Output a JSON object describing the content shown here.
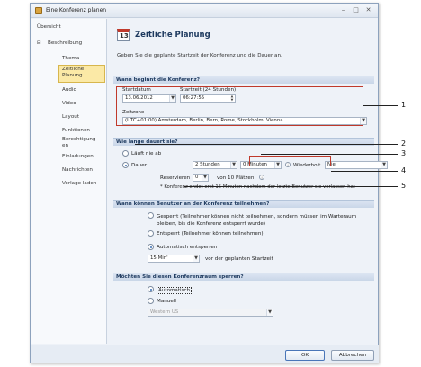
{
  "window": {
    "title": "Eine Konferenz planen"
  },
  "nav": {
    "items": [
      {
        "label": "Übersicht",
        "sub": false
      },
      {
        "label": "Beschreibung",
        "sub": false,
        "expanded_marker": "⊟"
      },
      {
        "label": "Thema",
        "sub": true
      },
      {
        "label": "Zeitliche\nPlanung",
        "sub": true,
        "selected": true
      },
      {
        "label": "Audio",
        "sub": true
      },
      {
        "label": "Video",
        "sub": true
      },
      {
        "label": "Layout",
        "sub": true
      },
      {
        "label": "Funktionen",
        "sub": true
      },
      {
        "label": "Berechtigung\nen",
        "sub": true
      },
      {
        "label": "Einladungen",
        "sub": true
      },
      {
        "label": "Nachrichten",
        "sub": true
      },
      {
        "label": "Vorlage laden",
        "sub": true
      }
    ]
  },
  "header": {
    "icon_day": "13",
    "title": "Zeitliche Planung",
    "description": "Geben Sie die geplante Startzeit der Konferenz und die Dauer an."
  },
  "start_section": {
    "heading": "Wann beginnt die Konferenz?",
    "date_label": "Startdatum",
    "date_value": "13.06.2012",
    "time_label": "Startzeit (24 Stunden)",
    "time_value": "06:27:55",
    "tz_label": "Zeitzone",
    "tz_value": "(UTC+01:00) Amsterdam, Berlin, Bern, Rome, Stockholm, Vienna"
  },
  "duration_section": {
    "heading": "Wie lange dauert sie?",
    "option_never": "Läuft nie ab",
    "option_duration": "Dauer",
    "hours_value": "2 Stunden",
    "minutes_value": "0 Minuten",
    "repeat_label": "Wiederholt",
    "repeat_value": "Nie",
    "reserve_label": "Reservieren",
    "reserve_value": "0",
    "reserve_suffix": "von 10 Plätzen",
    "note": "* Konferenz endet erst 15 Minuten nachdem der letzte Benutzer sie verlassen hat"
  },
  "join_section": {
    "heading": "Wann können Benutzer an der Konferenz teilnehmen?",
    "locked": "Gesperrt (Teilnehmer können nicht teilnehmen, sondern müssen im Warteraum bleiben, bis die Konferenz entsperrt wurde)",
    "unlocked": "Entsperrt (Teilnehmer können teilnehmen)",
    "auto": "Automatisch entsperren",
    "auto_value": "15 Min'",
    "auto_suffix": "vor der geplanten Startzeit"
  },
  "lock_section": {
    "heading": "Möchten Sie diesen Konferenzraum sperren?",
    "auto": "Automatisch",
    "manual": "Manuell",
    "manual_value": "Western US"
  },
  "footer": {
    "ok": "OK",
    "cancel": "Abbrechen"
  },
  "annotations": [
    "1",
    "2",
    "3",
    "4",
    "5"
  ]
}
